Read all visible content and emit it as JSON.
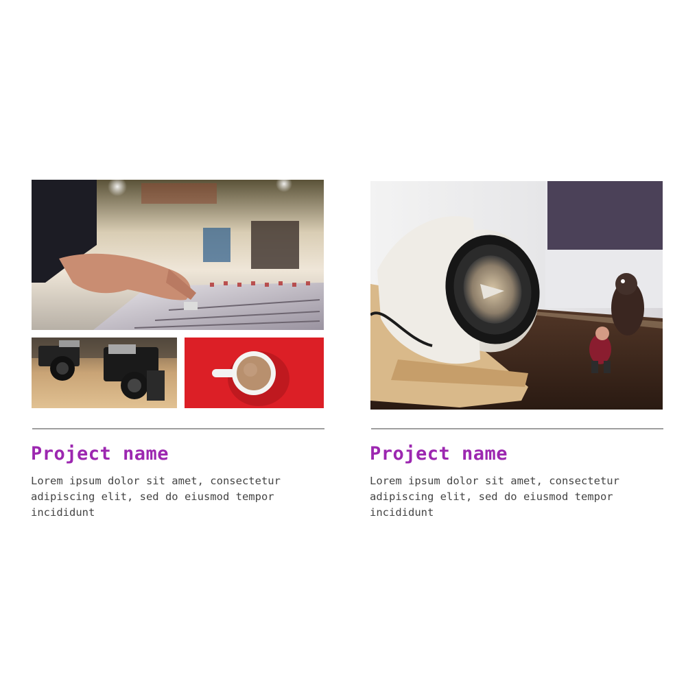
{
  "projects": [
    {
      "title": "Project name",
      "description": "Lorem ipsum dolor sit amet, consectetur adipiscing elit, sed do eiusmod tempor incididunt",
      "images": [
        "audio-mixer-photo",
        "vintage-cameras-photo",
        "coffee-cup-photo"
      ]
    },
    {
      "title": "Project name",
      "description": "Lorem ipsum dolor sit amet, consectetur adipiscing elit, sed do eiusmod tempor incididunt",
      "images": [
        "speaker-desk-photo"
      ]
    }
  ],
  "colors": {
    "accent": "#9c27b0",
    "text": "#444444",
    "divider": "#9e9e9e",
    "background": "#ffffff"
  }
}
